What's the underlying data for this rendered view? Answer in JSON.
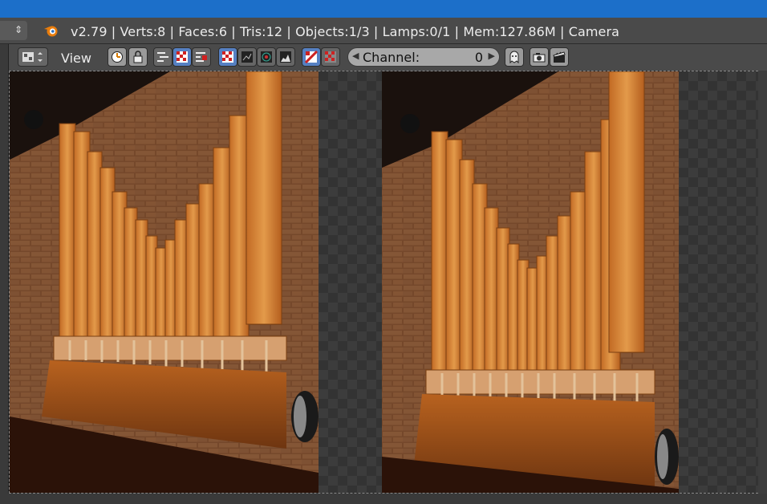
{
  "info_bar": {
    "stats": "v2.79 | Verts:8 | Faces:6 | Tris:12 | Objects:1/3 | Lamps:0/1 | Mem:127.86M | Camera"
  },
  "toolbar": {
    "view_menu": "View",
    "channel_label": "Channel:",
    "channel_value": "0"
  },
  "icons": [
    "blender-logo-icon",
    "editor-type-icon",
    "clock-icon",
    "lock-icon",
    "sequencer-view-icon",
    "preview-view-icon",
    "both-views-icon",
    "checker-display-icon",
    "waveform-icon",
    "vectorscope-icon",
    "histogram-icon",
    "overlay-icon",
    "backdrop-icon",
    "ghost-icon",
    "camera-render-icon",
    "clapper-render-icon"
  ],
  "colors": {
    "title_bar": "#1c6fc9",
    "header_bg": "#4a4a4a",
    "active_toggle": "#5680c2"
  }
}
